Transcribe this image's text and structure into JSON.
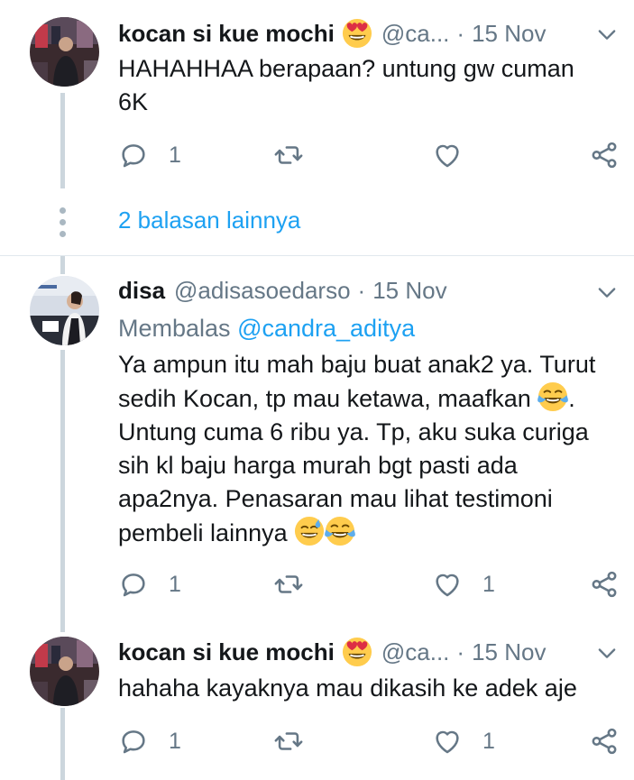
{
  "colors": {
    "link": "#1da1f2",
    "secondary_text": "#657786",
    "thread_line": "#ccd6dd",
    "divider": "#e1e8ed"
  },
  "tweets": [
    {
      "name": "kocan si kue mochi",
      "name_emoji": "smiling-face-with-heart-eyes",
      "handle": "@ca...",
      "separator": "·",
      "date": "15 Nov",
      "text": "HAHAHHAA berapaan? untung gw cuman 6K",
      "reply_count": "1",
      "like_count": ""
    },
    {
      "name": "disa",
      "handle": "@adisasoedarso",
      "separator": "·",
      "date": "15 Nov",
      "replying_prefix": "Membalas",
      "replying_to": "@candra_aditya",
      "text_part1": "Ya ampun itu mah baju buat anak2 ya. Turut sedih Kocan, tp mau ketawa, maafkan",
      "text_part2": ". Untung cuma 6 ribu ya. Tp, aku suka curiga sih kl baju harga murah bgt pasti ada apa2nya. Penasaran mau lihat testimoni pembeli lainnya",
      "reply_count": "1",
      "like_count": "1"
    },
    {
      "name": "kocan si kue mochi",
      "name_emoji": "smiling-face-with-heart-eyes",
      "handle": "@ca...",
      "separator": "·",
      "date": "15 Nov",
      "text": "hahaha kayaknya mau dikasih ke adek aje",
      "reply_count": "1",
      "like_count": "1"
    }
  ],
  "more_replies_label": "2 balasan lainnya"
}
